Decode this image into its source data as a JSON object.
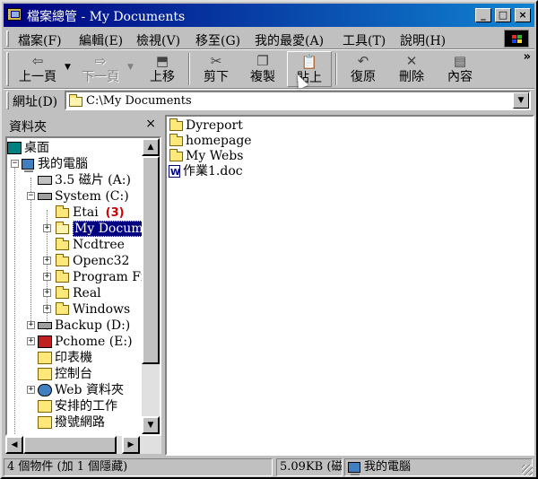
{
  "window": {
    "title": "檔案總管 - My Documents"
  },
  "menu": [
    "檔案(F)",
    "編輯(E)",
    "檢視(V)",
    "移至(G)",
    "我的最愛(A)",
    "工具(T)",
    "說明(H)"
  ],
  "toolbar": {
    "back": "上一頁",
    "forward": "下一頁",
    "up": "上移",
    "cut": "剪下",
    "copy": "複製",
    "paste": "貼上",
    "undo": "復原",
    "delete": "刪除",
    "properties": "內容"
  },
  "address": {
    "label": "網址(D)",
    "value": "C:\\My Documents"
  },
  "folders_pane": {
    "title": "資料夾",
    "close": "×",
    "tree": {
      "desktop": "桌面",
      "my_computer": "我的電腦",
      "floppy": "3.5 磁片 (A:)",
      "system": "System (C:)",
      "etai": "Etai",
      "annotation": "(3)",
      "my_documents": "My Docume",
      "ncdtree": "Ncdtree",
      "openc32": "Openc32",
      "program_files": "Program Fil",
      "real": "Real",
      "windows": "Windows",
      "backup": "Backup (D:)",
      "pchome": "Pchome (E:)",
      "printers": "印表機",
      "control_panel": "控制台",
      "web_folders": "Web 資料夾",
      "scheduled_tasks": "安排的工作",
      "dialup": "撥號網路"
    }
  },
  "files": [
    {
      "name": "Dyreport",
      "type": "folder"
    },
    {
      "name": "homepage",
      "type": "folder"
    },
    {
      "name": "My Webs",
      "type": "folder"
    },
    {
      "name": "作業1.doc",
      "type": "doc"
    }
  ],
  "status": {
    "objects": "4 個物件 (加 1 個隱藏)",
    "size": "5.09KB (磁",
    "location": "我的電腦"
  },
  "colors": {
    "titlebar": "#000080",
    "selection": "#000080",
    "annotation": "#d00000"
  }
}
